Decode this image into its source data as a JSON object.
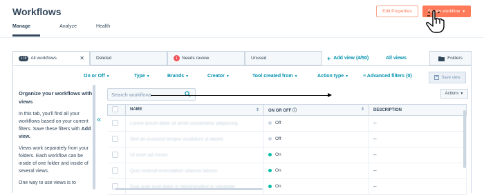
{
  "header": {
    "title": "Workflows",
    "edit_properties": "Edit Properties",
    "create_workflow": "Create workflow"
  },
  "tabs": [
    {
      "label": "Manage"
    },
    {
      "label": "Analyze"
    },
    {
      "label": "Health"
    }
  ],
  "views": {
    "all_count": "178",
    "all_label": "All workflows",
    "deleted": "Deleted",
    "needs_review_count": "1",
    "needs_review": "Needs review",
    "unused": "Unused",
    "add_view": "Add view (4/50)",
    "all_views": "All views",
    "folders": "Folders"
  },
  "filters": {
    "on_off": "On or Off",
    "type": "Type",
    "brands": "Brands",
    "creator": "Creator",
    "tool": "Tool created from",
    "action_type": "Action type",
    "advanced": "Advanced filters (0)",
    "save_view": "Save view"
  },
  "sidebar": {
    "heading": "Organize your workflows with views",
    "p1a": "In this tab, you'll find all your workflows based on your current filters. Save these filters with ",
    "p1b": "Add view.",
    "p2": "Views work separately from your folders. Each workflow can be inside of one folder and inside of several views.",
    "p3": "One way to use views is to"
  },
  "grid": {
    "search_placeholder": "Search workflows",
    "actions": "Actions",
    "columns": {
      "name": "NAME",
      "status": "ON OR OFF",
      "description": "DESCRIPTION"
    },
    "rows": [
      {
        "name": "Lorem ipsum dolor sit amet consectetur adipiscing",
        "status": "Off",
        "desc": "--"
      },
      {
        "name": "Sed do eiusmod tempor incididunt ut labore",
        "status": "Off",
        "desc": "--"
      },
      {
        "name": "Ut enim ad minim",
        "status": "On",
        "desc": "--"
      },
      {
        "name": "Quis nostrud exercitation ullamco laboris",
        "status": "On",
        "desc": "--"
      },
      {
        "name": "Duis aute irure dolor in reprehenderit in voluptate",
        "status": "On",
        "desc": "--"
      }
    ]
  },
  "colors": {
    "accent": "#ff7a59",
    "link": "#0091ae",
    "on": "#00bda5",
    "off": "#cbd6e2"
  }
}
